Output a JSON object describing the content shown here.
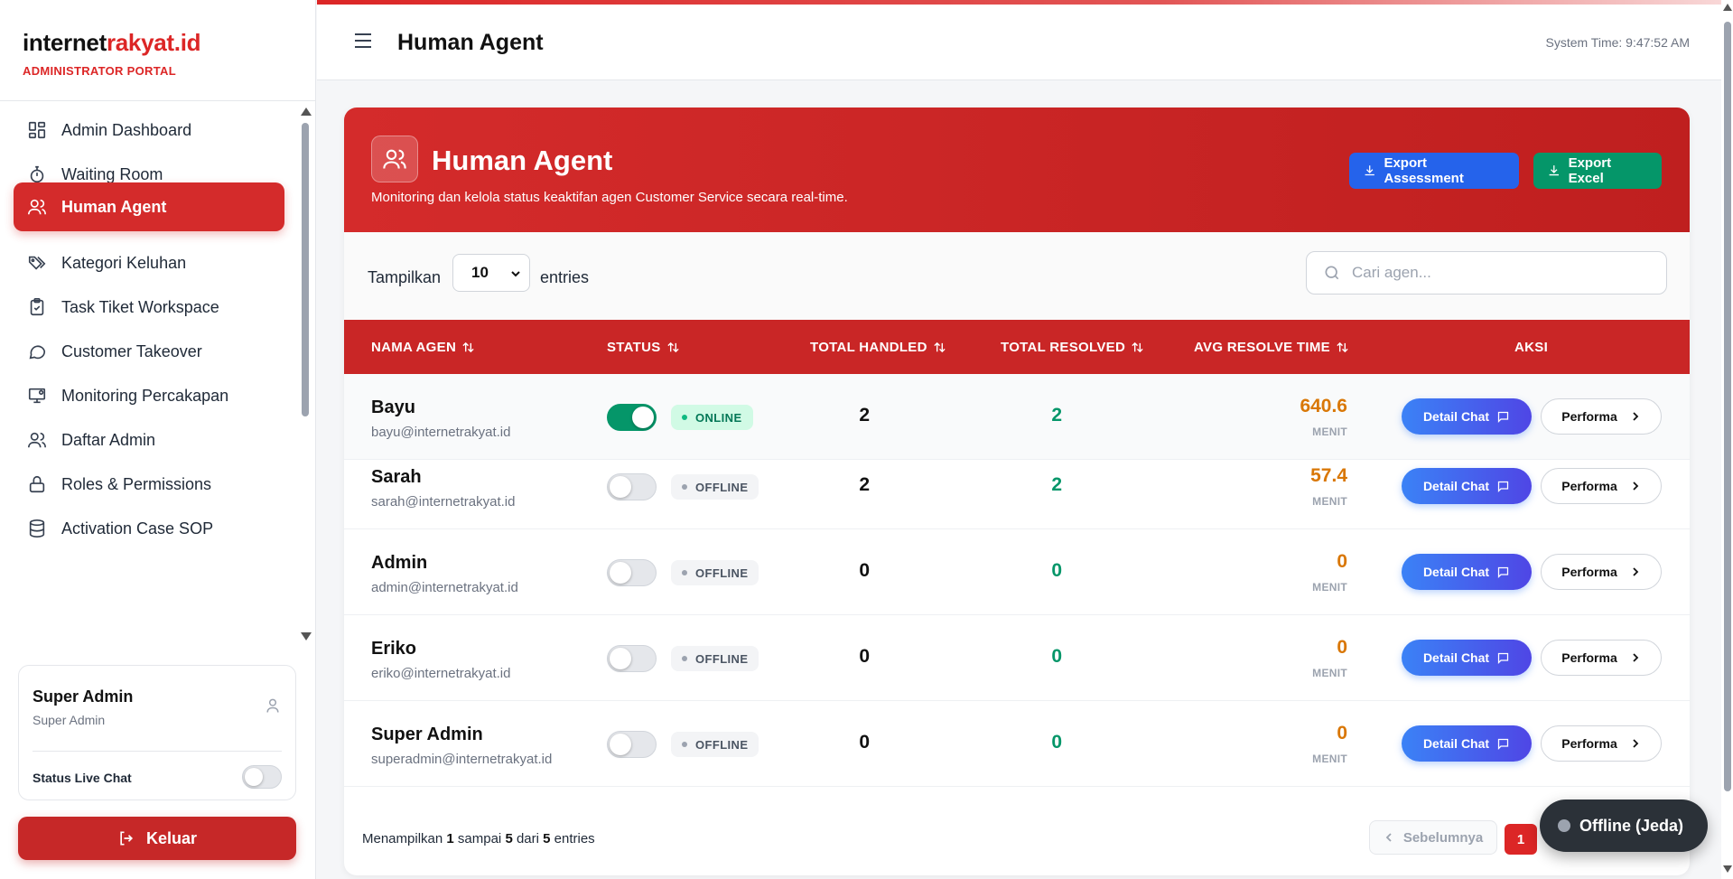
{
  "brand": {
    "name_part1": "internet",
    "name_part2": "rakyat.id",
    "subtitle": "ADMINISTRATOR PORTAL"
  },
  "sidebar": {
    "items": [
      {
        "label": "Admin Dashboard",
        "icon": "dashboard-icon"
      },
      {
        "label": "Waiting Room",
        "icon": "stopwatch-icon"
      },
      {
        "label": "Human Agent",
        "icon": "users-icon",
        "active": true
      },
      {
        "label": "Kategori Keluhan",
        "icon": "tags-icon"
      },
      {
        "label": "Task Tiket Workspace",
        "icon": "clipboard-check-icon"
      },
      {
        "label": "Customer Takeover",
        "icon": "chat-bubble-icon"
      },
      {
        "label": "Monitoring Percakapan",
        "icon": "monitor-icon"
      },
      {
        "label": "Daftar Admin",
        "icon": "users-icon"
      },
      {
        "label": "Roles & Permissions",
        "icon": "lock-icon"
      },
      {
        "label": "Activation Case SOP",
        "icon": "database-icon"
      }
    ]
  },
  "user": {
    "name": "Super Admin",
    "role": "Super Admin",
    "live_chat_label": "Status Live Chat",
    "live_chat_on": false
  },
  "logout_label": "Keluar",
  "topbar": {
    "title": "Human Agent",
    "system_time": "System Time: 9:47:52 AM"
  },
  "hero": {
    "title": "Human Agent",
    "subtitle": "Monitoring dan kelola status keaktifan agen Customer Service secara real-time.",
    "export_assessment": "Export Assessment",
    "export_excel": "Export Excel"
  },
  "controls": {
    "show_label": "Tampilkan",
    "entries_value": "10",
    "entries_label": "entries",
    "search_placeholder": "Cari agen..."
  },
  "table": {
    "headers": [
      "NAMA AGEN",
      "STATUS",
      "TOTAL HANDLED",
      "TOTAL RESOLVED",
      "AVG RESOLVE TIME",
      "AKSI"
    ],
    "rows": [
      {
        "name": "Bayu",
        "email": "bayu@internetrakyat.id",
        "online": true,
        "status": "ONLINE",
        "handled": "2",
        "resolved": "2",
        "avg": "640.6",
        "unit": "MENIT"
      },
      {
        "name": "Sarah",
        "email": "sarah@internetrakyat.id",
        "online": false,
        "status": "OFFLINE",
        "handled": "2",
        "resolved": "2",
        "avg": "57.4",
        "unit": "MENIT"
      },
      {
        "name": "Admin",
        "email": "admin@internetrakyat.id",
        "online": false,
        "status": "OFFLINE",
        "handled": "0",
        "resolved": "0",
        "avg": "0",
        "unit": "MENIT"
      },
      {
        "name": "Eriko",
        "email": "eriko@internetrakyat.id",
        "online": false,
        "status": "OFFLINE",
        "handled": "0",
        "resolved": "0",
        "avg": "0",
        "unit": "MENIT"
      },
      {
        "name": "Super Admin",
        "email": "superadmin@internetrakyat.id",
        "online": false,
        "status": "OFFLINE",
        "handled": "0",
        "resolved": "0",
        "avg": "0",
        "unit": "MENIT"
      }
    ],
    "detail_label": "Detail Chat",
    "perf_label": "Performa"
  },
  "footer": {
    "prefix": "Menampilkan",
    "from": "1",
    "mid1": "sampai",
    "to": "5",
    "mid2": "dari",
    "total": "5",
    "suffix": "entries",
    "prev_label": "Sebelumnya",
    "page": "1"
  },
  "float_status": "Offline (Jeda)",
  "colors": {
    "accent": "#d42b2b",
    "online": "#059669",
    "warning": "#d97706",
    "primary": "#2563eb"
  }
}
